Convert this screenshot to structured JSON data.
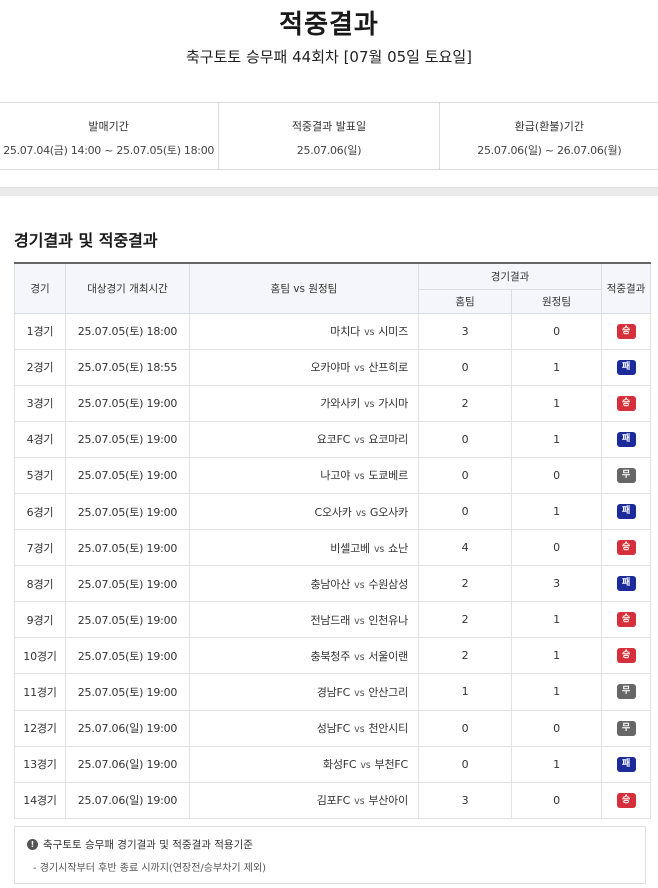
{
  "page": {
    "title": "적중결과",
    "subtitle": "축구토토 승무패 44회차 [07월 05일 토요일]"
  },
  "info": [
    {
      "label": "발매기간",
      "value": "25.07.04(금) 14:00 ~ 25.07.05(토) 18:00"
    },
    {
      "label": "적중결과 발표일",
      "value": "25.07.06(일)"
    },
    {
      "label": "환급(환불)기간",
      "value": "25.07.06(일) ~ 26.07.06(월)"
    }
  ],
  "section": {
    "title": "경기결과 및 적중결과"
  },
  "table": {
    "headers": {
      "game": "경기",
      "time": "대상경기 개최시간",
      "teams": "홈팀 vs 원정팀",
      "result_group": "경기결과",
      "home": "홈팀",
      "away": "원정팀",
      "outcome": "적중결과"
    },
    "vs_label": "vs",
    "rows": [
      {
        "game": "1경기",
        "time": "25.07.05(토) 18:00",
        "home_team": "마치다",
        "away_team": "시미즈",
        "home_score": "3",
        "away_score": "0",
        "outcome": "승",
        "outcome_type": "win"
      },
      {
        "game": "2경기",
        "time": "25.07.05(토) 18:55",
        "home_team": "오카야마",
        "away_team": "산프히로",
        "home_score": "0",
        "away_score": "1",
        "outcome": "패",
        "outcome_type": "lose"
      },
      {
        "game": "3경기",
        "time": "25.07.05(토) 19:00",
        "home_team": "가와사키",
        "away_team": "가시마",
        "home_score": "2",
        "away_score": "1",
        "outcome": "승",
        "outcome_type": "win"
      },
      {
        "game": "4경기",
        "time": "25.07.05(토) 19:00",
        "home_team": "요코FC",
        "away_team": "요코마리",
        "home_score": "0",
        "away_score": "1",
        "outcome": "패",
        "outcome_type": "lose"
      },
      {
        "game": "5경기",
        "time": "25.07.05(토) 19:00",
        "home_team": "나고야",
        "away_team": "도쿄베르",
        "home_score": "0",
        "away_score": "0",
        "outcome": "무",
        "outcome_type": "draw"
      },
      {
        "game": "6경기",
        "time": "25.07.05(토) 19:00",
        "home_team": "C오사카",
        "away_team": "G오사카",
        "home_score": "0",
        "away_score": "1",
        "outcome": "패",
        "outcome_type": "lose"
      },
      {
        "game": "7경기",
        "time": "25.07.05(토) 19:00",
        "home_team": "비셀고베",
        "away_team": "쇼난",
        "home_score": "4",
        "away_score": "0",
        "outcome": "승",
        "outcome_type": "win"
      },
      {
        "game": "8경기",
        "time": "25.07.05(토) 19:00",
        "home_team": "충남아산",
        "away_team": "수원삼성",
        "home_score": "2",
        "away_score": "3",
        "outcome": "패",
        "outcome_type": "lose"
      },
      {
        "game": "9경기",
        "time": "25.07.05(토) 19:00",
        "home_team": "전남드래",
        "away_team": "인천유나",
        "home_score": "2",
        "away_score": "1",
        "outcome": "승",
        "outcome_type": "win"
      },
      {
        "game": "10경기",
        "time": "25.07.05(토) 19:00",
        "home_team": "충북청주",
        "away_team": "서울이랜",
        "home_score": "2",
        "away_score": "1",
        "outcome": "승",
        "outcome_type": "win"
      },
      {
        "game": "11경기",
        "time": "25.07.05(토) 19:00",
        "home_team": "경남FC",
        "away_team": "안산그리",
        "home_score": "1",
        "away_score": "1",
        "outcome": "무",
        "outcome_type": "draw"
      },
      {
        "game": "12경기",
        "time": "25.07.06(일) 19:00",
        "home_team": "성남FC",
        "away_team": "천안시티",
        "home_score": "0",
        "away_score": "0",
        "outcome": "무",
        "outcome_type": "draw"
      },
      {
        "game": "13경기",
        "time": "25.07.06(일) 19:00",
        "home_team": "화성FC",
        "away_team": "부천FC",
        "home_score": "0",
        "away_score": "1",
        "outcome": "패",
        "outcome_type": "lose"
      },
      {
        "game": "14경기",
        "time": "25.07.06(일) 19:00",
        "home_team": "김포FC",
        "away_team": "부산아이",
        "home_score": "3",
        "away_score": "0",
        "outcome": "승",
        "outcome_type": "win"
      }
    ]
  },
  "note": {
    "icon": "info-icon",
    "icon_glyph": "!",
    "title": "축구토토 승무패 경기결과 및 적중결과 적용기준",
    "item": "- 경기시작부터 후반 종료 시까지(연장전/승부차기 제외)"
  },
  "colors": {
    "win": "#d42f3a",
    "lose": "#1c2a9a",
    "draw": "#666666",
    "header_bg": "#f4f6fb"
  }
}
